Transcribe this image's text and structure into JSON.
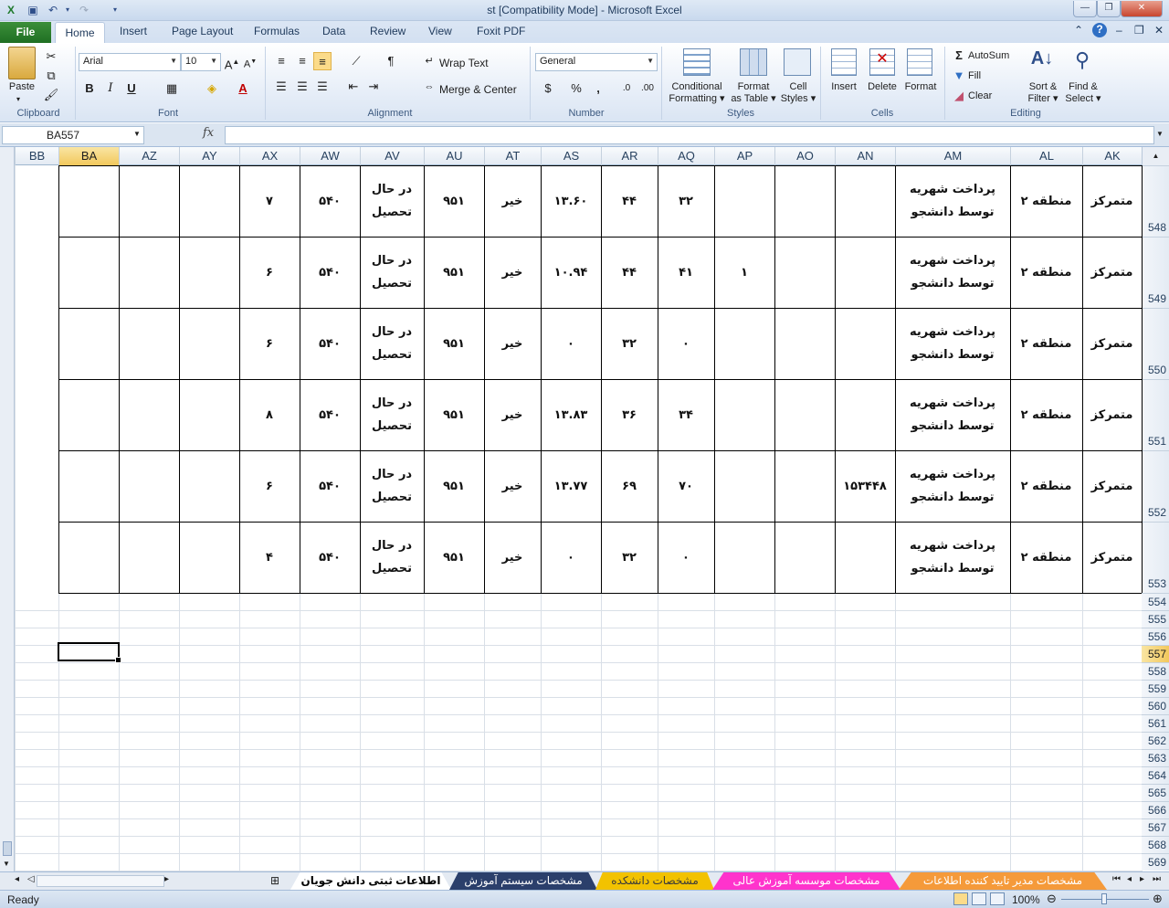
{
  "window": {
    "title": "st  [Compatibility Mode]  -  Microsoft Excel",
    "minimize": "—",
    "restore": "❐",
    "close": "✕"
  },
  "ribbon": {
    "file_tab": "File",
    "tabs": [
      "Home",
      "Insert",
      "Page Layout",
      "Formulas",
      "Data",
      "Review",
      "View",
      "Foxit PDF"
    ],
    "clipboard": {
      "label": "Clipboard",
      "paste": "Paste"
    },
    "font": {
      "label": "Font",
      "name": "Arial",
      "size": "10",
      "bold": "B",
      "italic": "I",
      "underline": "U"
    },
    "alignment": {
      "label": "Alignment",
      "wrap_text": "Wrap Text",
      "merge_center": "Merge & Center"
    },
    "number": {
      "label": "Number",
      "format": "General",
      "percent": "%",
      "comma": ","
    },
    "styles": {
      "label": "Styles",
      "conditional": "Conditional",
      "conditional2": "Formatting",
      "format_table": "Format",
      "format_table2": "as Table",
      "cell_styles": "Cell",
      "cell_styles2": "Styles"
    },
    "cells": {
      "label": "Cells",
      "insert": "Insert",
      "delete": "Delete",
      "format": "Format"
    },
    "editing": {
      "label": "Editing",
      "autosum": "AutoSum",
      "fill": "Fill",
      "clear": "Clear",
      "sort": "Sort &",
      "sort2": "Filter",
      "find": "Find &",
      "find2": "Select"
    }
  },
  "formula_bar": {
    "name_box": "BA557",
    "fx": "fx",
    "value": ""
  },
  "columns": [
    "BB",
    "BA",
    "AZ",
    "AY",
    "AX",
    "AW",
    "AV",
    "AU",
    "AT",
    "AS",
    "AR",
    "AQ",
    "AP",
    "AO",
    "AN",
    "AM",
    "AL",
    "AK"
  ],
  "selected_column": "BA",
  "rows": [
    {
      "num": "548",
      "AX": "۷",
      "AW": "۵۴۰",
      "AV": "در حال تحصیل",
      "AU": "۹۵۱",
      "AT": "خیر",
      "AS": "۱۳.۶۰",
      "AR": "۴۴",
      "AQ": "۳۲",
      "AP": "",
      "AN": "",
      "AM": "پرداخت شهریه توسط دانشجو",
      "AL": "منطقه ۲",
      "AK": "متمرکز"
    },
    {
      "num": "549",
      "AX": "۶",
      "AW": "۵۴۰",
      "AV": "در حال تحصیل",
      "AU": "۹۵۱",
      "AT": "خیر",
      "AS": "۱۰.۹۴",
      "AR": "۴۴",
      "AQ": "۴۱",
      "AP": "۱",
      "AN": "",
      "AM": "پرداخت شهریه توسط دانشجو",
      "AL": "منطقه ۲",
      "AK": "متمرکز"
    },
    {
      "num": "550",
      "AX": "۶",
      "AW": "۵۴۰",
      "AV": "در حال تحصیل",
      "AU": "۹۵۱",
      "AT": "خیر",
      "AS": "۰",
      "AR": "۳۲",
      "AQ": "۰",
      "AP": "",
      "AN": "",
      "AM": "پرداخت شهریه توسط دانشجو",
      "AL": "منطقه ۲",
      "AK": "متمرکز"
    },
    {
      "num": "551",
      "AX": "۸",
      "AW": "۵۴۰",
      "AV": "در حال تحصیل",
      "AU": "۹۵۱",
      "AT": "خیر",
      "AS": "۱۳.۸۳",
      "AR": "۳۶",
      "AQ": "۳۴",
      "AP": "",
      "AN": "",
      "AM": "پرداخت شهریه توسط دانشجو",
      "AL": "منطقه ۲",
      "AK": "متمرکز"
    },
    {
      "num": "552",
      "AX": "۶",
      "AW": "۵۴۰",
      "AV": "در حال تحصیل",
      "AU": "۹۵۱",
      "AT": "خیر",
      "AS": "۱۳.۷۷",
      "AR": "۶۹",
      "AQ": "۷۰",
      "AP": "",
      "AN": "۱۵۳۴۴۸",
      "AM": "پرداخت شهریه توسط دانشجو",
      "AL": "منطقه ۲",
      "AK": "متمرکز"
    },
    {
      "num": "553",
      "AX": "۴",
      "AW": "۵۴۰",
      "AV": "در حال تحصیل",
      "AU": "۹۵۱",
      "AT": "خیر",
      "AS": "۰",
      "AR": "۳۲",
      "AQ": "۰",
      "AP": "",
      "AN": "",
      "AM": "پرداخت شهریه توسط دانشجو",
      "AL": "منطقه ۲",
      "AK": "متمرکز"
    }
  ],
  "empty_rows": [
    "554",
    "555",
    "556",
    "557",
    "558",
    "559",
    "560",
    "561",
    "562",
    "563",
    "564",
    "565",
    "566",
    "567",
    "568",
    "569"
  ],
  "selected_row": "557",
  "sheet_tabs": [
    {
      "name": "اطلاعات ثبتی دانش جویان",
      "color": "#ffffff",
      "active": true
    },
    {
      "name": "مشخصات سیستم آموزش",
      "color": "#2b3f6b",
      "active": false
    },
    {
      "name": "مشخصات دانشکده",
      "color": "#f2c200",
      "active": false
    },
    {
      "name": "مشخصات موسسه آموزش عالی",
      "color": "#ff33cc",
      "active": false
    },
    {
      "name": "مشخصات مدیر تایید کننده اطلاعات",
      "color": "#f59a3a",
      "active": false
    }
  ],
  "status": {
    "ready": "Ready",
    "zoom": "100%"
  }
}
